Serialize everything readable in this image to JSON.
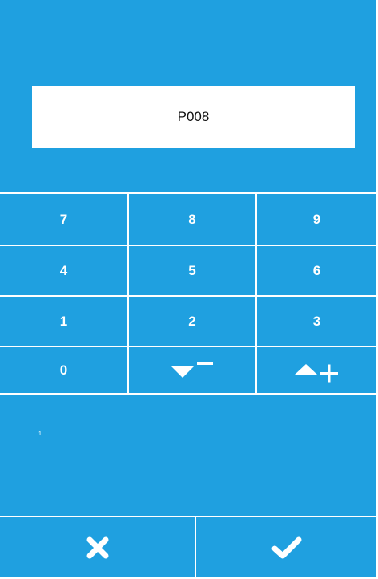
{
  "display": {
    "value": "P008"
  },
  "keypad": {
    "rows": [
      [
        "7",
        "8",
        "9"
      ],
      [
        "4",
        "5",
        "6"
      ],
      [
        "1",
        "2",
        "3"
      ],
      [
        "0",
        "",
        ""
      ]
    ],
    "decrement_icon": "down-triangle-minus-icon",
    "increment_icon": "up-triangle-plus-icon"
  },
  "hint_text": "1",
  "footer": {
    "cancel_icon": "cross-icon",
    "confirm_icon": "check-icon"
  },
  "colors": {
    "background": "#1fa0e0",
    "foreground": "#ffffff",
    "display_bg": "#ffffff",
    "display_text": "#111111"
  }
}
